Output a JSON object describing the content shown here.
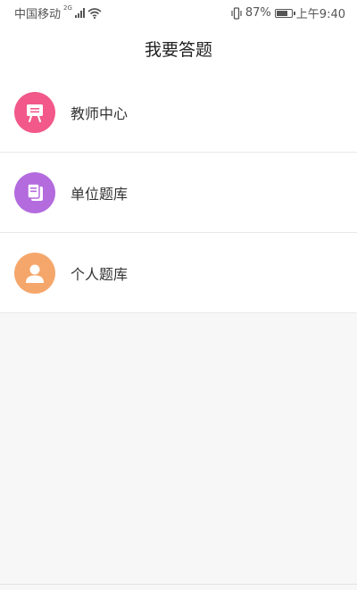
{
  "status_bar": {
    "carrier": "中国移动",
    "network": "2G",
    "battery": "87%",
    "battery_level": 0.87,
    "time": "上午9:40"
  },
  "header": {
    "title": "我要答题"
  },
  "menu": {
    "items": [
      {
        "label": "教师中心",
        "icon": "presentation-board-icon",
        "color": "#f2588a"
      },
      {
        "label": "单位题库",
        "icon": "question-bank-icon",
        "color": "#b36bde"
      },
      {
        "label": "个人题库",
        "icon": "person-icon",
        "color": "#f5a76b"
      }
    ]
  }
}
